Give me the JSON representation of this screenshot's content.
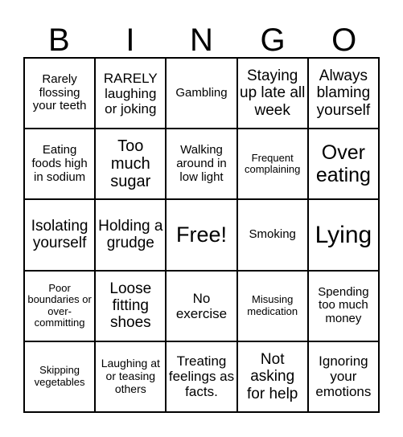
{
  "header": [
    "B",
    "I",
    "N",
    "G",
    "O"
  ],
  "cells": [
    [
      {
        "text": "Rarely flossing your teeth",
        "size": "s15"
      },
      {
        "text": "RARELY laughing or joking",
        "size": "s17"
      },
      {
        "text": "Gambling",
        "size": "s15"
      },
      {
        "text": "Staying up late all week",
        "size": "s19"
      },
      {
        "text": "Always blaming yourself",
        "size": "s19"
      }
    ],
    [
      {
        "text": "Eating foods high in sodium",
        "size": "s15"
      },
      {
        "text": "Too much sugar",
        "size": "s20"
      },
      {
        "text": "Walking around in low light",
        "size": "s15"
      },
      {
        "text": "Frequent complaining",
        "size": "s13"
      },
      {
        "text": "Over eating",
        "size": "s25"
      }
    ],
    [
      {
        "text": "Isolating yourself",
        "size": "s19"
      },
      {
        "text": "Holding a grudge",
        "size": "s19"
      },
      {
        "text": "Free!",
        "size": "s27"
      },
      {
        "text": "Smoking",
        "size": "s15"
      },
      {
        "text": "Lying",
        "size": "s30"
      }
    ],
    [
      {
        "text": "Poor boundaries or over-committing",
        "size": "s13"
      },
      {
        "text": "Loose fitting shoes",
        "size": "s19"
      },
      {
        "text": "No exercise",
        "size": "s17"
      },
      {
        "text": "Misusing medication",
        "size": "s13"
      },
      {
        "text": "Spending too much money",
        "size": "s15"
      }
    ],
    [
      {
        "text": "Skipping vegetables",
        "size": "s13"
      },
      {
        "text": "Laughing at or teasing others",
        "size": "s14"
      },
      {
        "text": "Treating feelings as facts.",
        "size": "s17"
      },
      {
        "text": "Not asking for help",
        "size": "s19"
      },
      {
        "text": "Ignoring your emotions",
        "size": "s17"
      }
    ]
  ]
}
